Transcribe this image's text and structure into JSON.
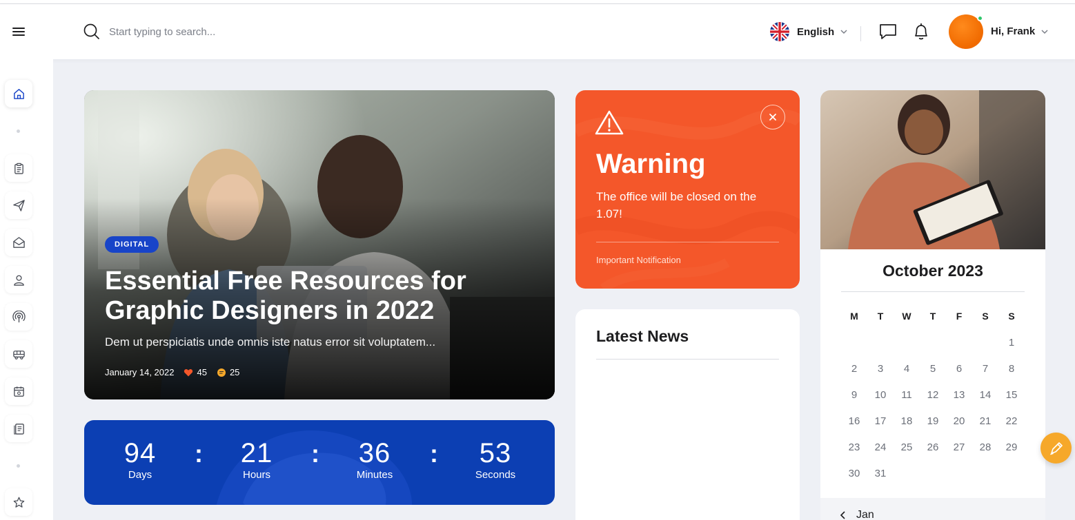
{
  "header": {
    "search_placeholder": "Start typing to search...",
    "language": "English",
    "greeting": "Hi,",
    "user_name": "Frank"
  },
  "sidebar": {
    "items": [
      {
        "icon": "home-icon",
        "active": true
      },
      {
        "icon": "clipboard-icon"
      },
      {
        "icon": "send-icon"
      },
      {
        "icon": "mail-icon"
      },
      {
        "icon": "user-icon"
      },
      {
        "icon": "podcast-icon"
      },
      {
        "icon": "shuttle-icon"
      },
      {
        "icon": "calendar-icon"
      },
      {
        "icon": "document-icon"
      },
      {
        "icon": "star-icon"
      }
    ]
  },
  "hero": {
    "tag": "DIGITAL",
    "title": "Essential Free Resources for Graphic Designers in 2022",
    "excerpt": "Dem ut perspiciatis unde omnis iste natus error sit voluptatem...",
    "date": "January 14, 2022",
    "likes": "45",
    "comments": "25"
  },
  "countdown": {
    "units": [
      {
        "value": "94",
        "label": "Days"
      },
      {
        "value": "21",
        "label": "Hours"
      },
      {
        "value": "36",
        "label": "Minutes"
      },
      {
        "value": "53",
        "label": "Seconds"
      }
    ],
    "separator": ":"
  },
  "warning": {
    "title": "Warning",
    "message": "The office will be closed on the 1.07!",
    "footer": "Important Notification"
  },
  "news": {
    "title": "Latest News"
  },
  "calendar": {
    "month_label": "October 2023",
    "weekdays": [
      "M",
      "T",
      "W",
      "T",
      "F",
      "S",
      "S"
    ],
    "days": [
      "1",
      "2",
      "3",
      "4",
      "5",
      "6",
      "7",
      "8",
      "9",
      "10",
      "11",
      "12",
      "13",
      "14",
      "15",
      "16",
      "17",
      "18",
      "19",
      "20",
      "21",
      "22",
      "23",
      "24",
      "25",
      "26",
      "27",
      "28",
      "29",
      "30",
      "31"
    ],
    "nav_month": "Jan"
  },
  "colors": {
    "accent_blue": "#1844c8",
    "countdown_blue": "#0c3fb3",
    "warning_orange": "#f4572a",
    "avatar_orange": "#f37b0c",
    "fab_yellow": "#f6a82a",
    "online_green": "#2ec66a"
  }
}
